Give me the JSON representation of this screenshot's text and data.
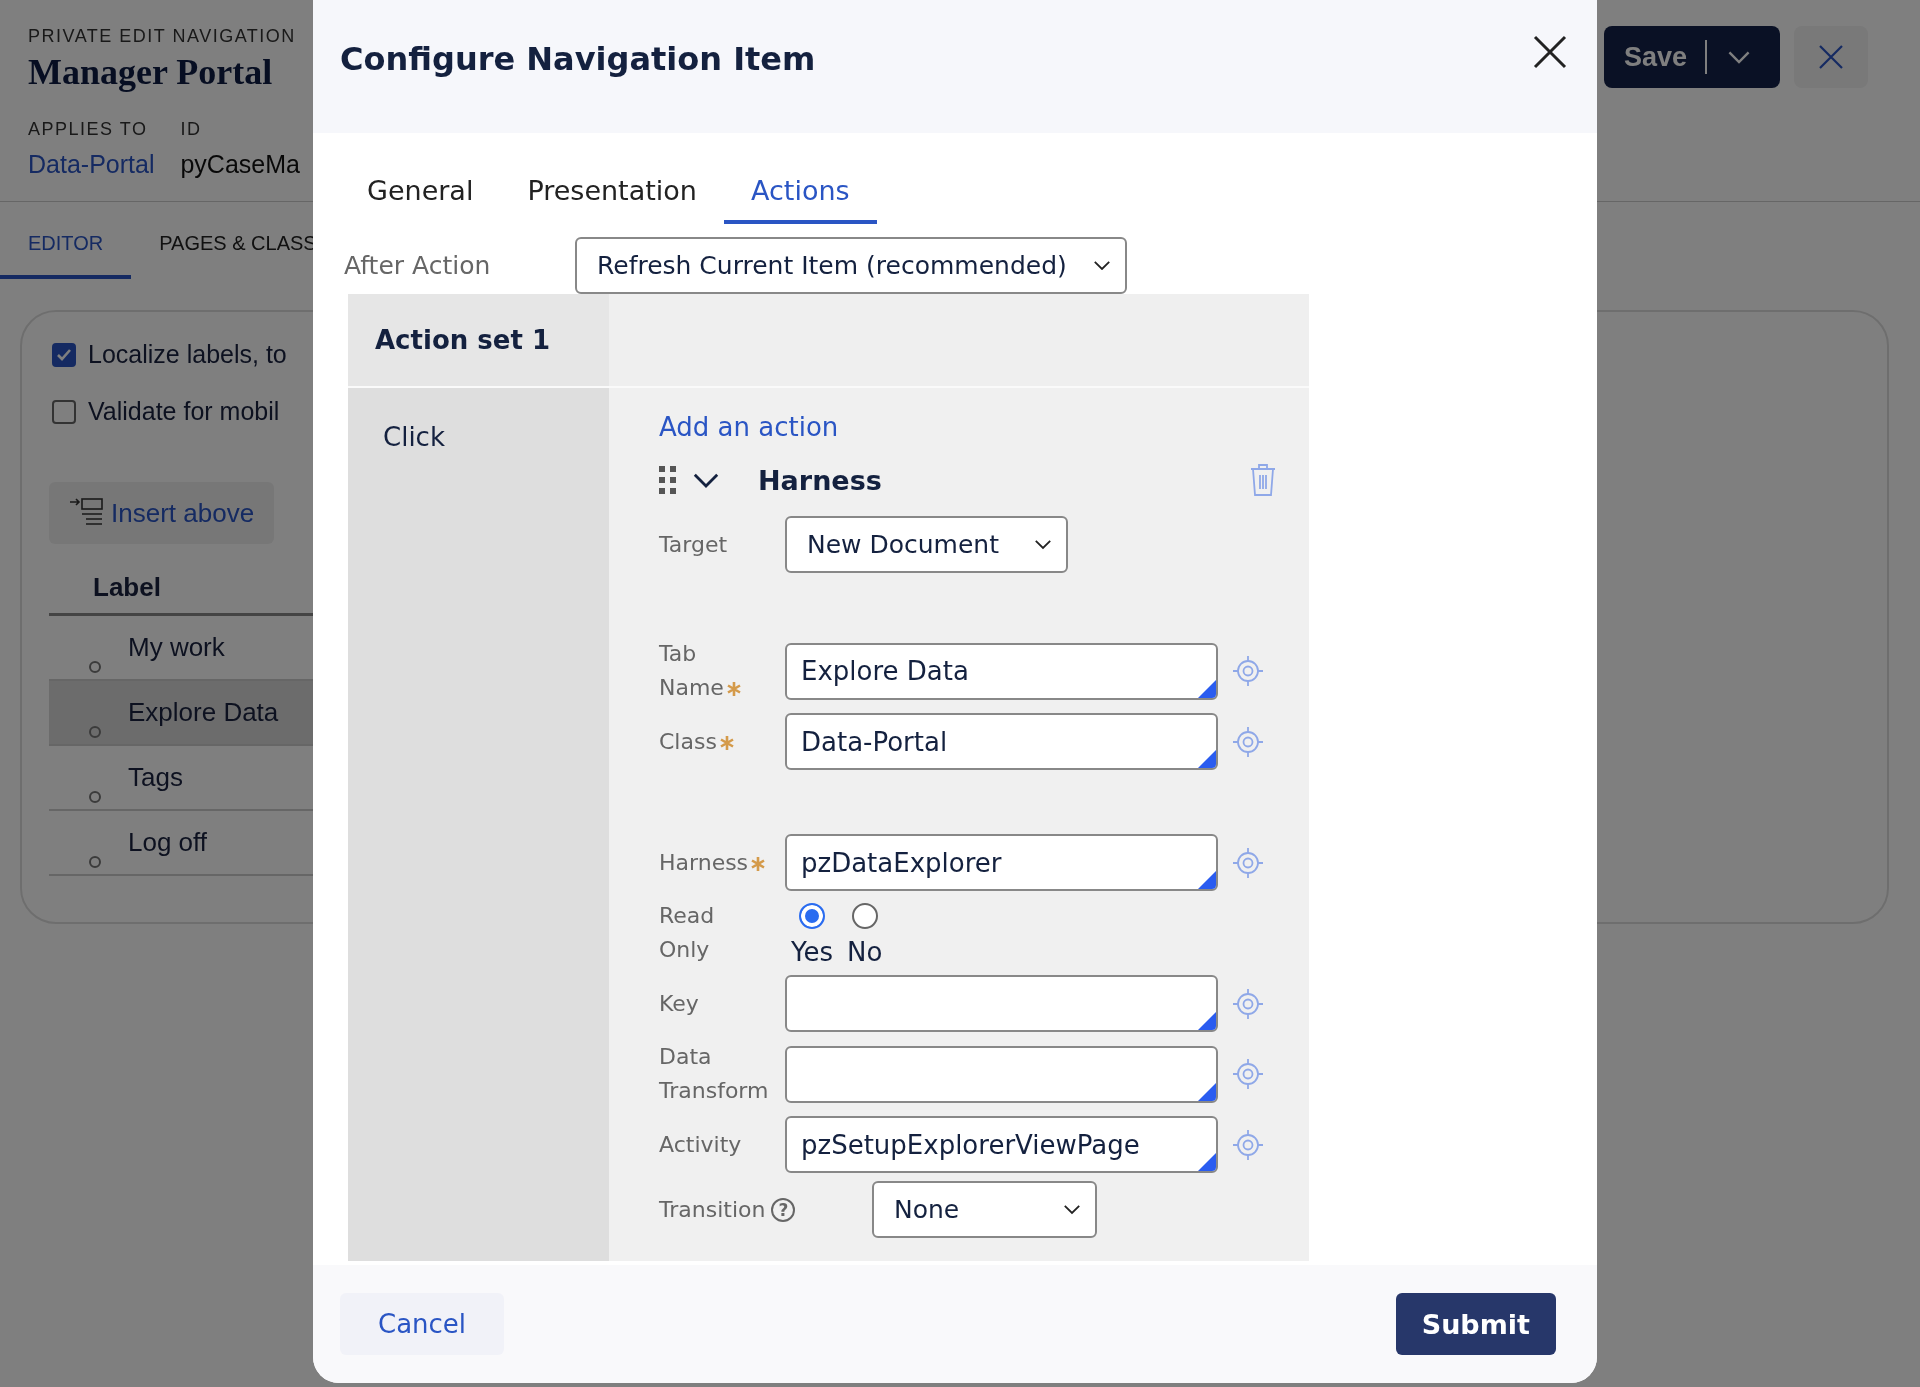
{
  "page": {
    "breadcrumb": "PRIVATE EDIT NAVIGATION",
    "title": "Manager Portal",
    "meta": [
      {
        "label": "APPLIES TO",
        "value": "Data-Portal",
        "kind": "link"
      },
      {
        "label": "ID",
        "value": "pyCaseMa",
        "kind": "text"
      }
    ],
    "tabs": [
      {
        "label": "EDITOR",
        "selected": true
      },
      {
        "label": "PAGES & CLASS",
        "selected": false
      }
    ],
    "options": [
      {
        "label": "Localize labels, to",
        "checked": true
      },
      {
        "label": "Validate for mobil",
        "checked": false
      }
    ],
    "insert_button": "Insert above",
    "table": {
      "columns": [
        "Label"
      ],
      "rows": [
        {
          "label": "My work",
          "selected": false
        },
        {
          "label": "Explore Data",
          "selected": true
        },
        {
          "label": "Tags",
          "selected": false
        },
        {
          "label": "Log off",
          "selected": false
        }
      ]
    },
    "save_button": "Save"
  },
  "dialog": {
    "title": "Configure Navigation Item",
    "tabs": [
      {
        "label": "General",
        "selected": false
      },
      {
        "label": "Presentation",
        "selected": false
      },
      {
        "label": "Actions",
        "selected": true
      }
    ],
    "after_action": {
      "label": "After Action",
      "value": "Refresh Current Item (recommended)"
    },
    "action_set": {
      "title": "Action set 1",
      "event": "Click",
      "add_link": "Add an action",
      "action": {
        "name": "Harness",
        "groups": [
          [
            {
              "kind": "select",
              "label": "Target",
              "value": "New Document"
            }
          ],
          [
            {
              "kind": "text",
              "label": "Tab Name",
              "required": true,
              "value": "Explore Data"
            },
            {
              "kind": "text",
              "label": "Class",
              "required": true,
              "value": "Data-Portal"
            }
          ],
          [
            {
              "kind": "text",
              "label": "Harness",
              "required": true,
              "value": "pzDataExplorer"
            },
            {
              "kind": "radio",
              "label": "Read Only",
              "options": [
                {
                  "label": "Yes",
                  "selected": true
                },
                {
                  "label": "No",
                  "selected": false
                }
              ]
            },
            {
              "kind": "text",
              "label": "Key"
            },
            {
              "kind": "text",
              "label": "Data Transform"
            },
            {
              "kind": "text",
              "label": "Activity",
              "value": "pzSetupExplorerViewPage"
            },
            {
              "kind": "select",
              "label": "Transition",
              "help": "?",
              "value": "None"
            }
          ]
        ]
      }
    },
    "buttons": {
      "cancel": "Cancel",
      "submit": "Submit"
    }
  }
}
